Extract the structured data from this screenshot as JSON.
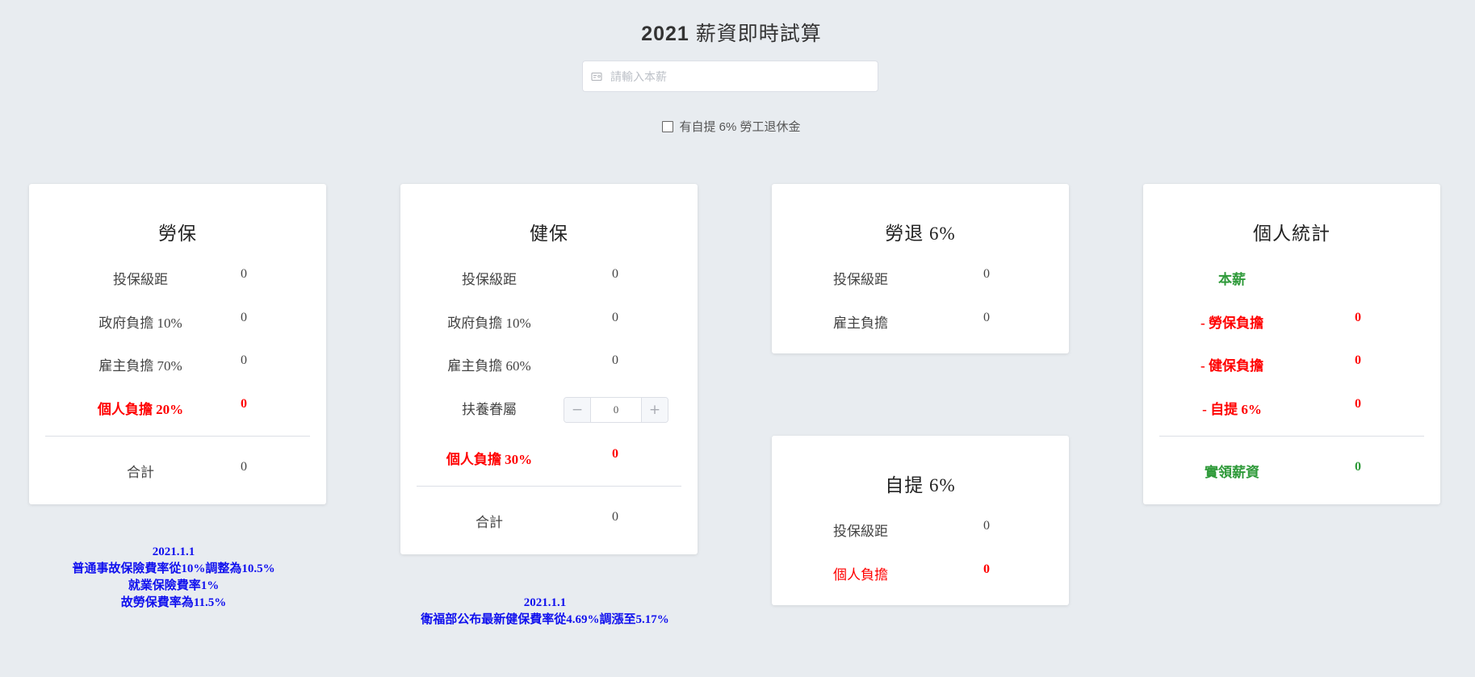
{
  "header": {
    "title_year": "2021",
    "title_text": "薪資即時試算"
  },
  "search": {
    "placeholder": "請輸入本薪",
    "value": "",
    "icon": "card-icon"
  },
  "option": {
    "label": "有自提 6% 勞工退休金",
    "checked": false
  },
  "labor": {
    "title": "勞保",
    "rows": [
      {
        "label": "投保級距",
        "value": "0"
      },
      {
        "label": "政府負擔 10%",
        "value": "0"
      },
      {
        "label": "雇主負擔 70%",
        "value": "0"
      },
      {
        "label": "個人負擔 20%",
        "value": "0"
      }
    ],
    "total": {
      "label": "合計",
      "value": "0"
    },
    "note": [
      "2021.1.1",
      "普通事故保險費率從10%調整為10.5%",
      "就業保險費率1%",
      "故勞保費率為11.5%"
    ]
  },
  "health": {
    "title": "健保",
    "rows": [
      {
        "label": "投保級距",
        "value": "0"
      },
      {
        "label": "政府負擔 10%",
        "value": "0"
      },
      {
        "label": "雇主負擔 60%",
        "value": "0"
      }
    ],
    "dependents": {
      "label": "扶養眷屬",
      "value": "0",
      "minus": "−",
      "plus": "+"
    },
    "personal": {
      "label": "個人負擔 30%",
      "value": "0"
    },
    "total": {
      "label": "合計",
      "value": "0"
    },
    "note": [
      "2021.1.1",
      "衛福部公布最新健保費率從4.69%調漲至5.17%"
    ]
  },
  "pension": {
    "title": "勞退 6%",
    "rows": [
      {
        "label": "投保級距",
        "value": "0"
      },
      {
        "label": "雇主負擔",
        "value": "0"
      }
    ]
  },
  "self": {
    "title": "自提 6%",
    "rows": [
      {
        "label": "投保級距",
        "value": "0"
      },
      {
        "label": "個人負擔",
        "value": "0"
      }
    ]
  },
  "stats": {
    "title": "個人統計",
    "rows": [
      {
        "label": "本薪",
        "value": ""
      },
      {
        "label": "- 勞保負擔",
        "value": "0"
      },
      {
        "label": "- 健保負擔",
        "value": "0"
      },
      {
        "label": "- 自提 6%",
        "value": "0"
      }
    ],
    "net": {
      "label": "實領薪資",
      "value": "0"
    }
  },
  "colors": {
    "accent_red": "#ff0000",
    "accent_green": "#2f9a3a",
    "note_blue": "#1010ee"
  }
}
